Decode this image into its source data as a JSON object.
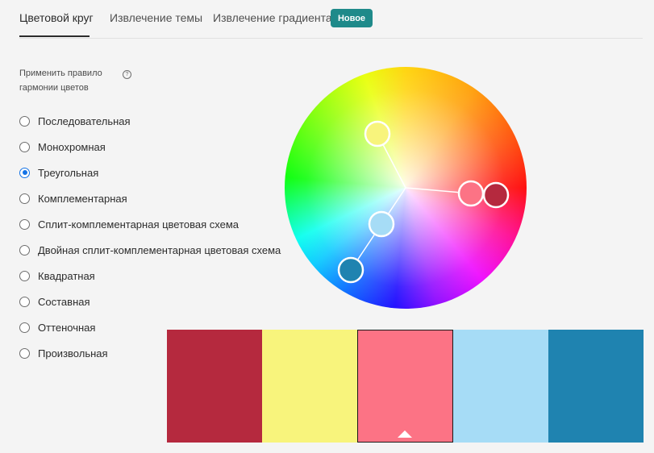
{
  "tabs": [
    {
      "label": "Цветовой круг",
      "active": true
    },
    {
      "label": "Извлечение темы",
      "active": false
    },
    {
      "label": "Извлечение градиента",
      "active": false
    }
  ],
  "badge": "Новое",
  "harmony": {
    "label": "Применить правило гармонии цветов",
    "help_icon": "question-circle-icon",
    "options": [
      {
        "label": "Последовательная",
        "checked": false
      },
      {
        "label": "Монохромная",
        "checked": false
      },
      {
        "label": "Треугольная",
        "checked": true
      },
      {
        "label": "Комплементарная",
        "checked": false
      },
      {
        "label": "Сплит-комплементарная цветовая схема",
        "checked": false
      },
      {
        "label": "Двойная сплит-комплементарная цветовая схема",
        "checked": false
      },
      {
        "label": "Квадратная",
        "checked": false
      },
      {
        "label": "Составная",
        "checked": false
      },
      {
        "label": "Оттеночная",
        "checked": false
      },
      {
        "label": "Произвольная",
        "checked": false
      }
    ]
  },
  "swatches": [
    {
      "color": "#b5293e",
      "selected": false
    },
    {
      "color": "#f8f47c",
      "selected": false
    },
    {
      "color": "#fc7385",
      "selected": true
    },
    {
      "color": "#a6dcf6",
      "selected": false
    },
    {
      "color": "#1f83b0",
      "selected": false
    }
  ],
  "colors": {
    "accent": "#1473e6",
    "badge": "#1f8a8a"
  }
}
